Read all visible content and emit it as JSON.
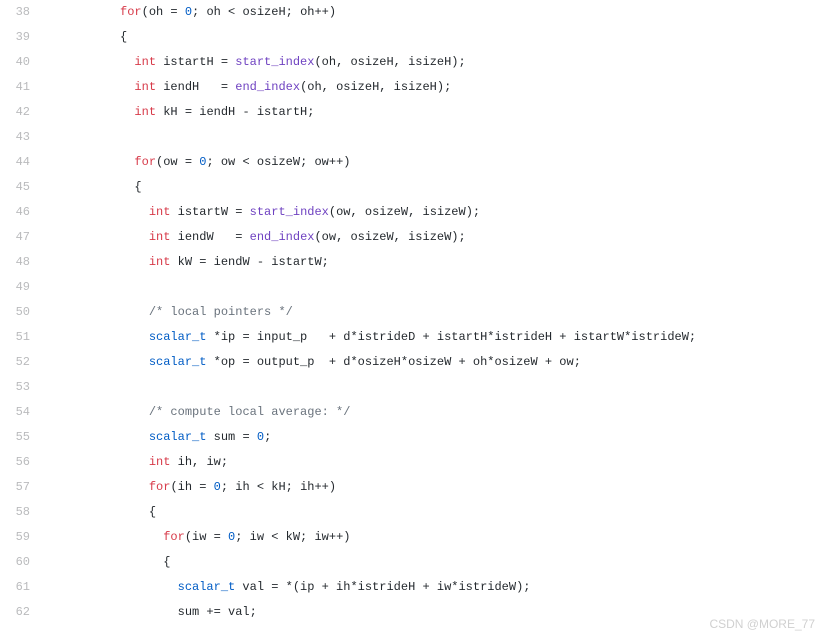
{
  "watermark": "CSDN @MORE_77",
  "lines": [
    {
      "num": "38",
      "indent": 10,
      "tokens": [
        {
          "t": "kw",
          "v": "for"
        },
        {
          "v": "(oh = "
        },
        {
          "t": "num",
          "v": "0"
        },
        {
          "v": "; oh < osizeH; oh++)"
        }
      ]
    },
    {
      "num": "39",
      "indent": 10,
      "tokens": [
        {
          "v": "{"
        }
      ]
    },
    {
      "num": "40",
      "indent": 12,
      "tokens": [
        {
          "t": "kw",
          "v": "int"
        },
        {
          "v": " istartH = "
        },
        {
          "t": "fn",
          "v": "start_index"
        },
        {
          "v": "(oh, osizeH, isizeH);"
        }
      ]
    },
    {
      "num": "41",
      "indent": 12,
      "tokens": [
        {
          "t": "kw",
          "v": "int"
        },
        {
          "v": " iendH   = "
        },
        {
          "t": "fn",
          "v": "end_index"
        },
        {
          "v": "(oh, osizeH, isizeH);"
        }
      ]
    },
    {
      "num": "42",
      "indent": 12,
      "tokens": [
        {
          "t": "kw",
          "v": "int"
        },
        {
          "v": " kH = iendH - istartH;"
        }
      ]
    },
    {
      "num": "43",
      "indent": 0,
      "tokens": []
    },
    {
      "num": "44",
      "indent": 12,
      "tokens": [
        {
          "t": "kw",
          "v": "for"
        },
        {
          "v": "(ow = "
        },
        {
          "t": "num",
          "v": "0"
        },
        {
          "v": "; ow < osizeW; ow++)"
        }
      ]
    },
    {
      "num": "45",
      "indent": 12,
      "tokens": [
        {
          "v": "{"
        }
      ]
    },
    {
      "num": "46",
      "indent": 14,
      "tokens": [
        {
          "t": "kw",
          "v": "int"
        },
        {
          "v": " istartW = "
        },
        {
          "t": "fn",
          "v": "start_index"
        },
        {
          "v": "(ow, osizeW, isizeW);"
        }
      ]
    },
    {
      "num": "47",
      "indent": 14,
      "tokens": [
        {
          "t": "kw",
          "v": "int"
        },
        {
          "v": " iendW   = "
        },
        {
          "t": "fn",
          "v": "end_index"
        },
        {
          "v": "(ow, osizeW, isizeW);"
        }
      ]
    },
    {
      "num": "48",
      "indent": 14,
      "tokens": [
        {
          "t": "kw",
          "v": "int"
        },
        {
          "v": " kW = iendW - istartW;"
        }
      ]
    },
    {
      "num": "49",
      "indent": 0,
      "tokens": []
    },
    {
      "num": "50",
      "indent": 14,
      "tokens": [
        {
          "t": "cmt",
          "v": "/* local pointers */"
        }
      ]
    },
    {
      "num": "51",
      "indent": 14,
      "tokens": [
        {
          "t": "num",
          "v": "scalar_t"
        },
        {
          "v": " *ip = input_p   + d*istrideD + istartH*istrideH + istartW*istrideW;"
        }
      ]
    },
    {
      "num": "52",
      "indent": 14,
      "tokens": [
        {
          "t": "num",
          "v": "scalar_t"
        },
        {
          "v": " *op = output_p  + d*osizeH*osizeW + oh*osizeW + ow;"
        }
      ]
    },
    {
      "num": "53",
      "indent": 0,
      "tokens": []
    },
    {
      "num": "54",
      "indent": 14,
      "tokens": [
        {
          "t": "cmt",
          "v": "/* compute local average: */"
        }
      ]
    },
    {
      "num": "55",
      "indent": 14,
      "tokens": [
        {
          "t": "num",
          "v": "scalar_t"
        },
        {
          "v": " sum = "
        },
        {
          "t": "num",
          "v": "0"
        },
        {
          "v": ";"
        }
      ]
    },
    {
      "num": "56",
      "indent": 14,
      "tokens": [
        {
          "t": "kw",
          "v": "int"
        },
        {
          "v": " ih, iw;"
        }
      ]
    },
    {
      "num": "57",
      "indent": 14,
      "tokens": [
        {
          "t": "kw",
          "v": "for"
        },
        {
          "v": "(ih = "
        },
        {
          "t": "num",
          "v": "0"
        },
        {
          "v": "; ih < kH; ih++)"
        }
      ]
    },
    {
      "num": "58",
      "indent": 14,
      "tokens": [
        {
          "v": "{"
        }
      ]
    },
    {
      "num": "59",
      "indent": 16,
      "tokens": [
        {
          "t": "kw",
          "v": "for"
        },
        {
          "v": "(iw = "
        },
        {
          "t": "num",
          "v": "0"
        },
        {
          "v": "; iw < kW; iw++)"
        }
      ]
    },
    {
      "num": "60",
      "indent": 16,
      "tokens": [
        {
          "v": "{"
        }
      ]
    },
    {
      "num": "61",
      "indent": 18,
      "tokens": [
        {
          "t": "num",
          "v": "scalar_t"
        },
        {
          "v": " val = *(ip + ih*istrideH + iw*istrideW);"
        }
      ]
    },
    {
      "num": "62",
      "indent": 18,
      "tokens": [
        {
          "v": "sum += val;"
        }
      ]
    }
  ]
}
